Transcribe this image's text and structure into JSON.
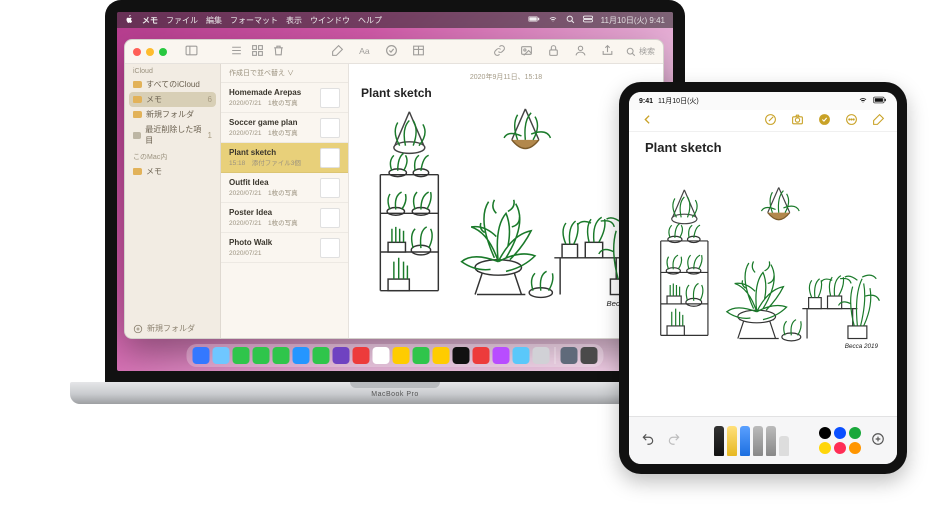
{
  "mac_menubar": {
    "app": "メモ",
    "items": [
      "ファイル",
      "編集",
      "フォーマット",
      "表示",
      "ウインドウ",
      "ヘルプ"
    ],
    "clock": "11月10日(火) 9:41"
  },
  "mac_label": "MacBook Pro",
  "notes_window": {
    "toolbar": {
      "search_placeholder": "検索"
    },
    "sidebar": {
      "section_icloud": "iCloud",
      "items": [
        {
          "label": "すべてのiCloud",
          "count": ""
        },
        {
          "label": "メモ",
          "count": "6"
        },
        {
          "label": "新規フォルダ",
          "count": ""
        },
        {
          "label": "最近削除した項目",
          "count": "1"
        }
      ],
      "section_local": "このMac内",
      "local_items": [
        {
          "label": "メモ",
          "count": ""
        }
      ],
      "footer": "新規フォルダ"
    },
    "notelist": {
      "sort_label": "作成日で並べ替え ∨",
      "items": [
        {
          "title": "Homemade Arepas",
          "date": "2020/07/21",
          "meta": "1枚の写真"
        },
        {
          "title": "Soccer game plan",
          "date": "2020/07/21",
          "meta": "1枚の写真"
        },
        {
          "title": "Plant sketch",
          "date": "15:18",
          "meta": "添付ファイル3個"
        },
        {
          "title": "Outfit Idea",
          "date": "2020/07/21",
          "meta": "1枚の写真"
        },
        {
          "title": "Poster Idea",
          "date": "2020/07/21",
          "meta": "1枚の写真"
        },
        {
          "title": "Photo Walk",
          "date": "2020/07/21",
          "meta": ""
        }
      ],
      "selected": 2
    },
    "editor": {
      "timestamp": "2020年9月11日、15:18",
      "title": "Plant sketch"
    }
  },
  "ipad": {
    "status": {
      "time": "9:41",
      "date": "11月10日(火)"
    },
    "editor": {
      "title": "Plant sketch"
    },
    "markup": {
      "colors": [
        "#000000",
        "#0a4fff",
        "#19a83b",
        "#ffd60a",
        "#ff2d55",
        "#ff9500"
      ]
    }
  },
  "dock_colors": [
    "#3478ff",
    "#6fc7ff",
    "#2fc54b",
    "#2fc54b",
    "#2fc54b",
    "#2596ff",
    "#2fc54b",
    "#6f42c1",
    "#ed3b3b",
    "#ffffff",
    "#ffcc00",
    "#2fc54b",
    "#ffcc00",
    "#111111",
    "#ed3b3b",
    "#b84dff",
    "#5ac8fa",
    "#d1d1d6",
    "#5f6a7a",
    "#4a4a4a"
  ]
}
